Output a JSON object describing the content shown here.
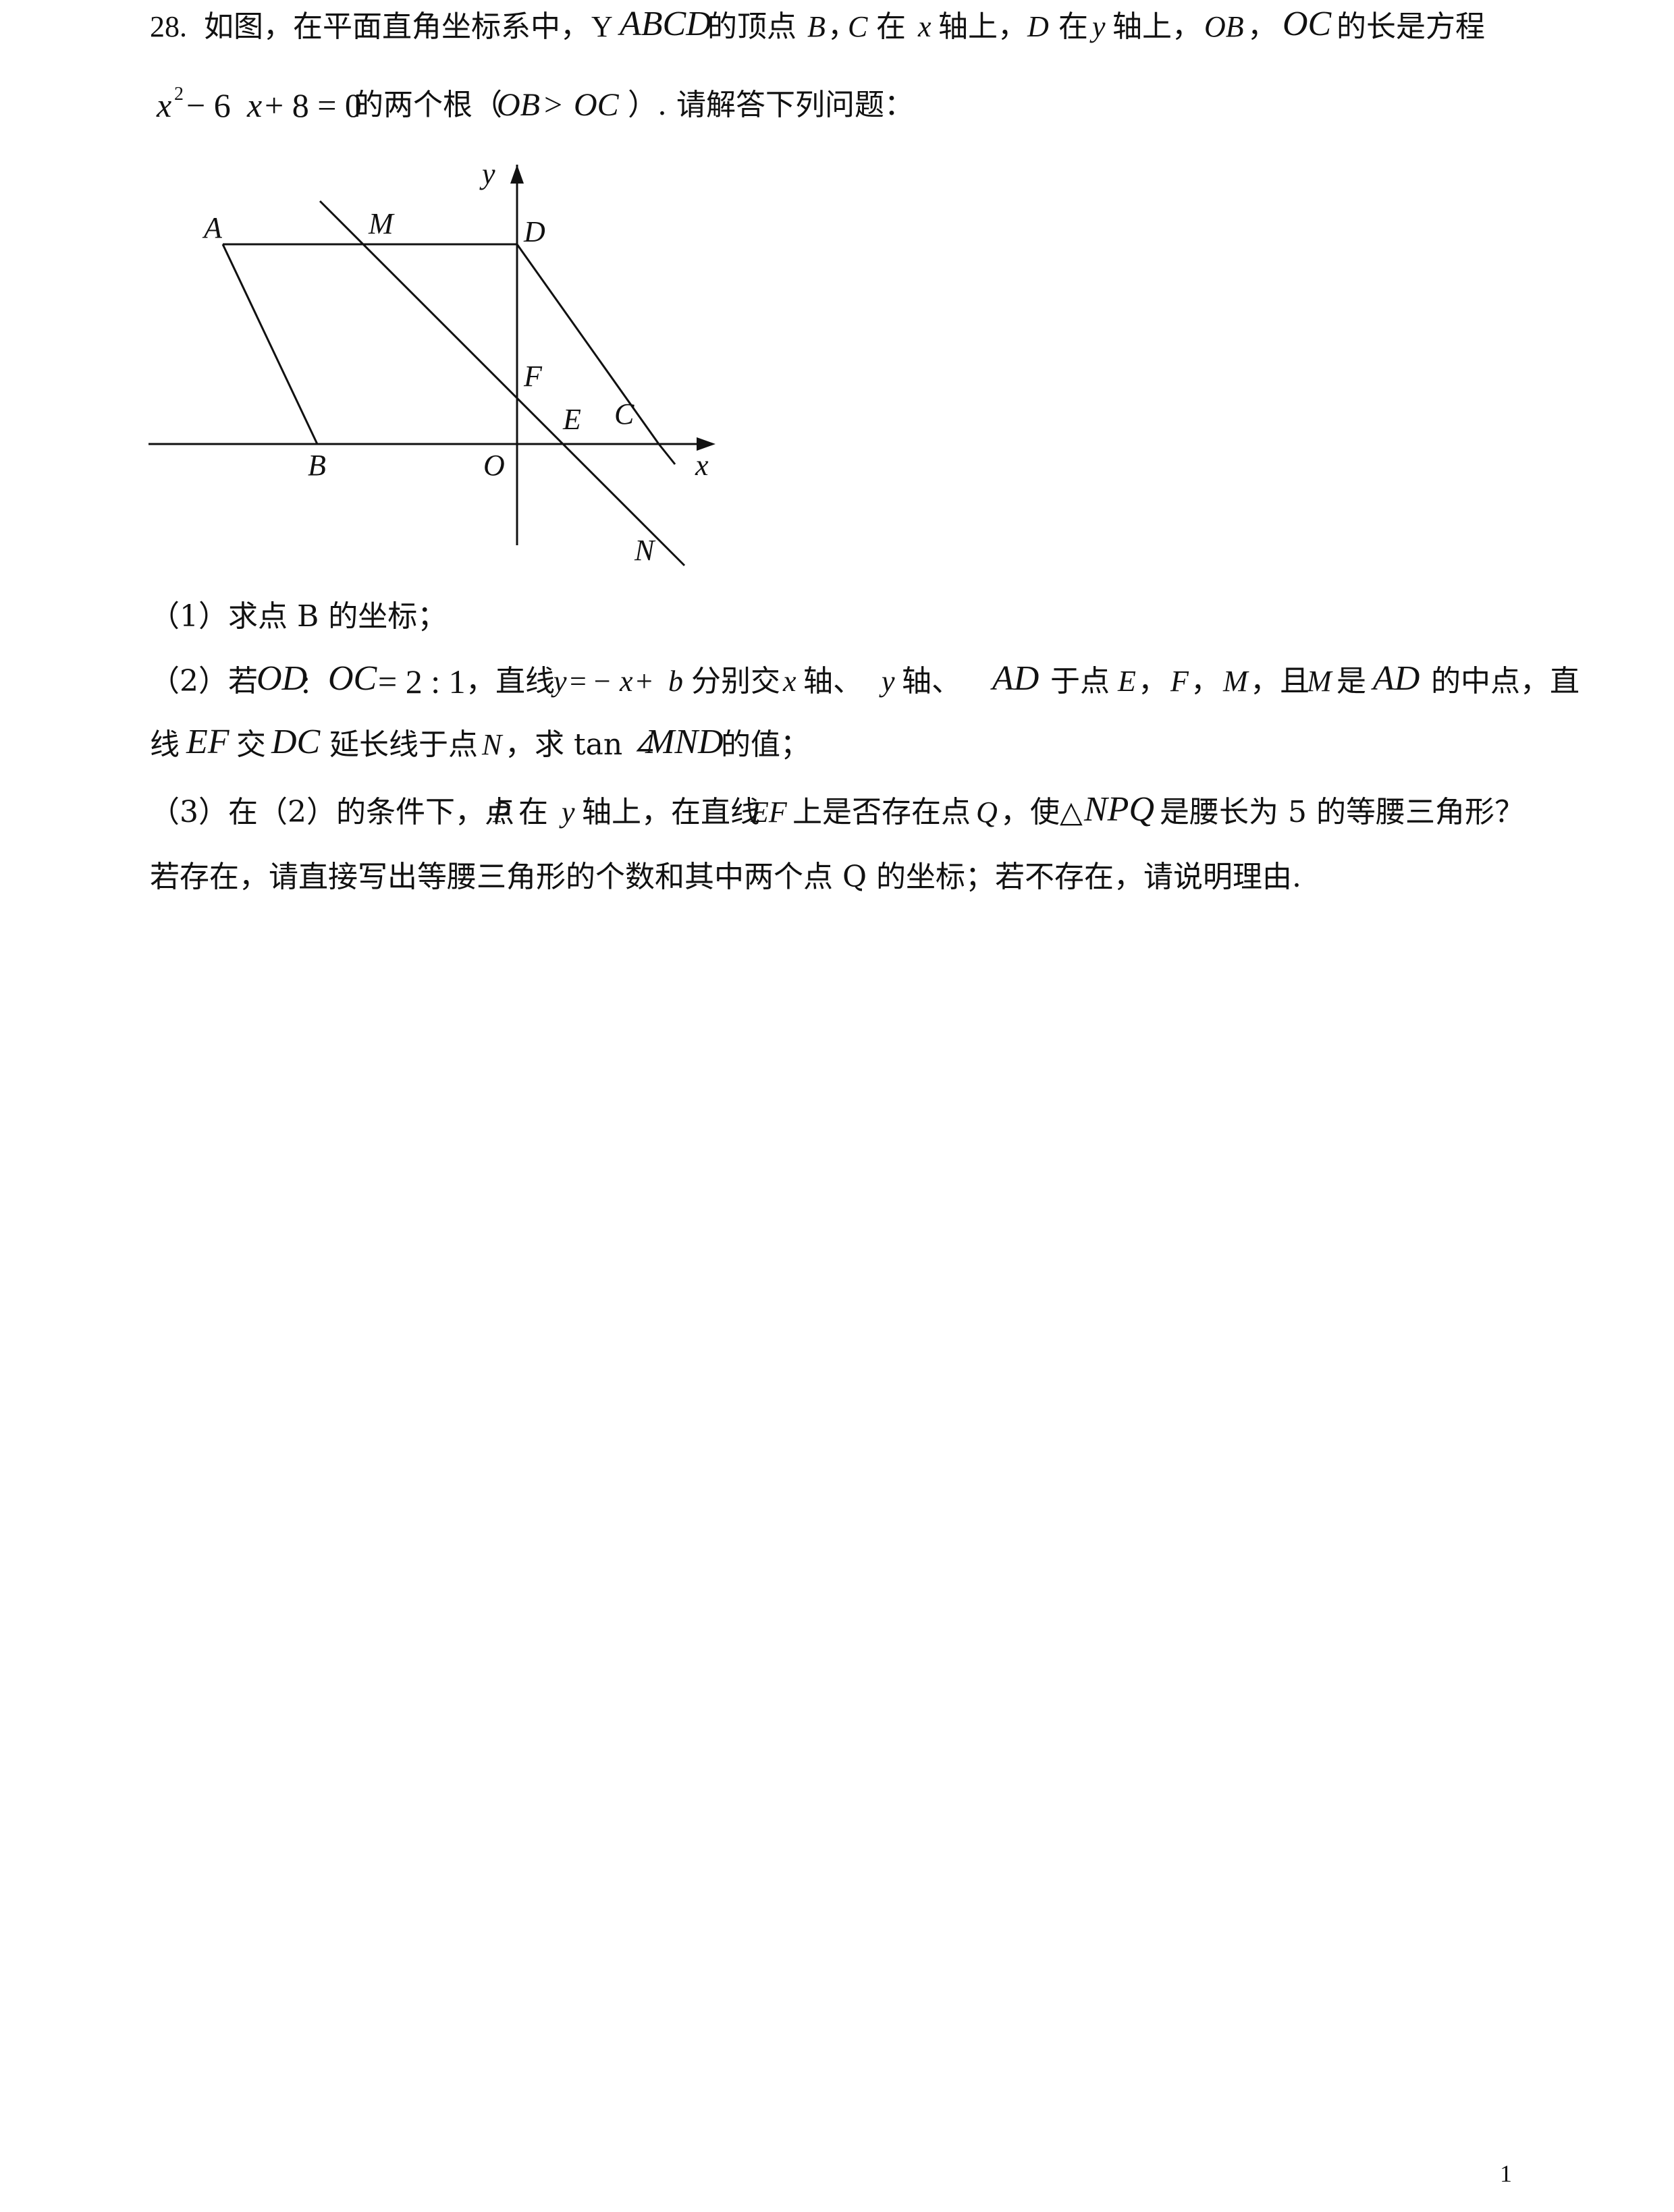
{
  "question": {
    "number": "28.",
    "stem_line1_parts": [
      "如图，在平面直角坐标系中，",
      "Y",
      "ABCD",
      "的顶点",
      "B",
      "，",
      "C",
      "在",
      "x",
      "轴上，",
      "D",
      "在",
      "y",
      "轴上，",
      "OB",
      "，",
      "OC",
      "的长是方程"
    ],
    "stem_line2_parts": [
      "x",
      "2",
      " − 6",
      "x",
      " + 8 = 0",
      "的两个根（",
      "OB",
      " > ",
      "OC",
      "）. 请解答下列问题："
    ],
    "part1": "（1）求点 B 的坐标；",
    "part2_line1_parts": [
      "（2）若",
      "OD",
      " : ",
      "OC",
      " = 2 : 1",
      "，直线",
      "y",
      " = −",
      "x",
      " + ",
      "b",
      "分别交",
      "x",
      "轴、",
      "y",
      "轴、",
      "AD",
      "于点",
      "E",
      "，",
      "F",
      "，",
      "M",
      "，且",
      "M",
      "是",
      "AD",
      "的中点，直"
    ],
    "part2_line2_parts": [
      "线",
      "EF",
      "交",
      "DC",
      "延长线于点",
      "N",
      "，求 tan ∠",
      "MND",
      "的值；"
    ],
    "part3_line1_parts": [
      "（3）在（2）的条件下，点",
      "P",
      "在",
      "y",
      "轴上，在直线",
      "EF",
      "上是否存在点",
      "Q",
      "，使△",
      "NPQ",
      "是腰长为 5 的等腰三角形？"
    ],
    "part3_line2": "若存在，请直接写出等腰三角形的个数和其中两个点 Q 的坐标；若不存在，请说明理由."
  },
  "figure": {
    "labels": {
      "A": "A",
      "M": "M",
      "D": "D",
      "y": "y",
      "F": "F",
      "E": "E",
      "C": "C",
      "B": "B",
      "O": "O",
      "x": "x",
      "N": "N"
    }
  },
  "page_number": "1"
}
